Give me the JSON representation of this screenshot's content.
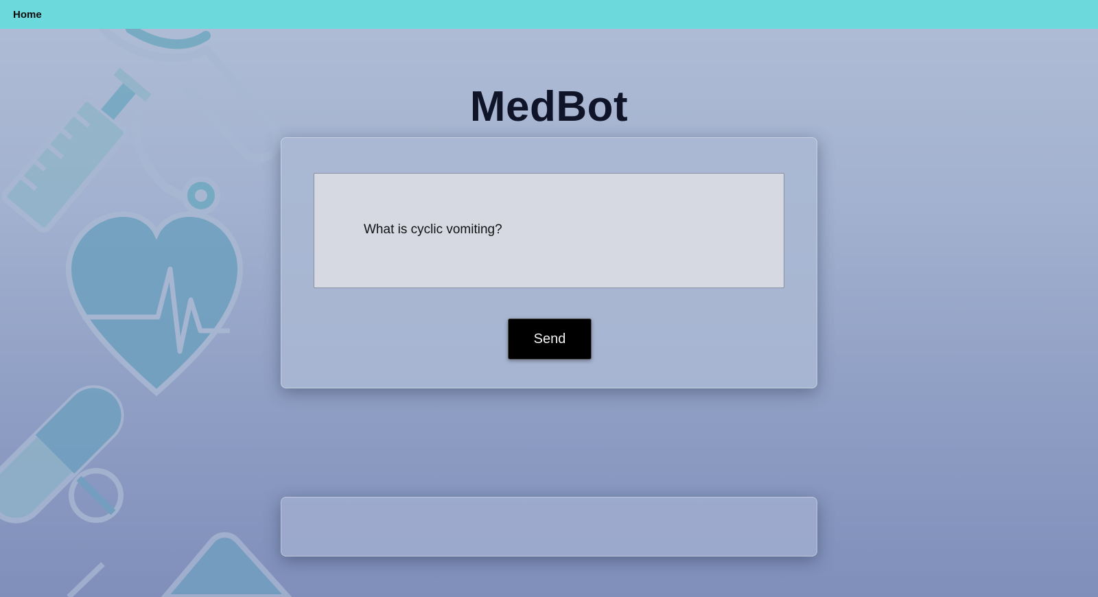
{
  "nav": {
    "home_label": "Home"
  },
  "app": {
    "title": "MedBot"
  },
  "chat": {
    "question_value": "What is cyclic vomiting?",
    "send_label": "Send"
  },
  "response": {
    "text": ""
  },
  "colors": {
    "navbar": "#6cd9dc",
    "button": "#000000",
    "title": "#0f1428"
  },
  "background_icons": [
    "stethoscope-icon",
    "syringe-icon",
    "heart-pulse-icon",
    "pill-capsule-icon"
  ]
}
